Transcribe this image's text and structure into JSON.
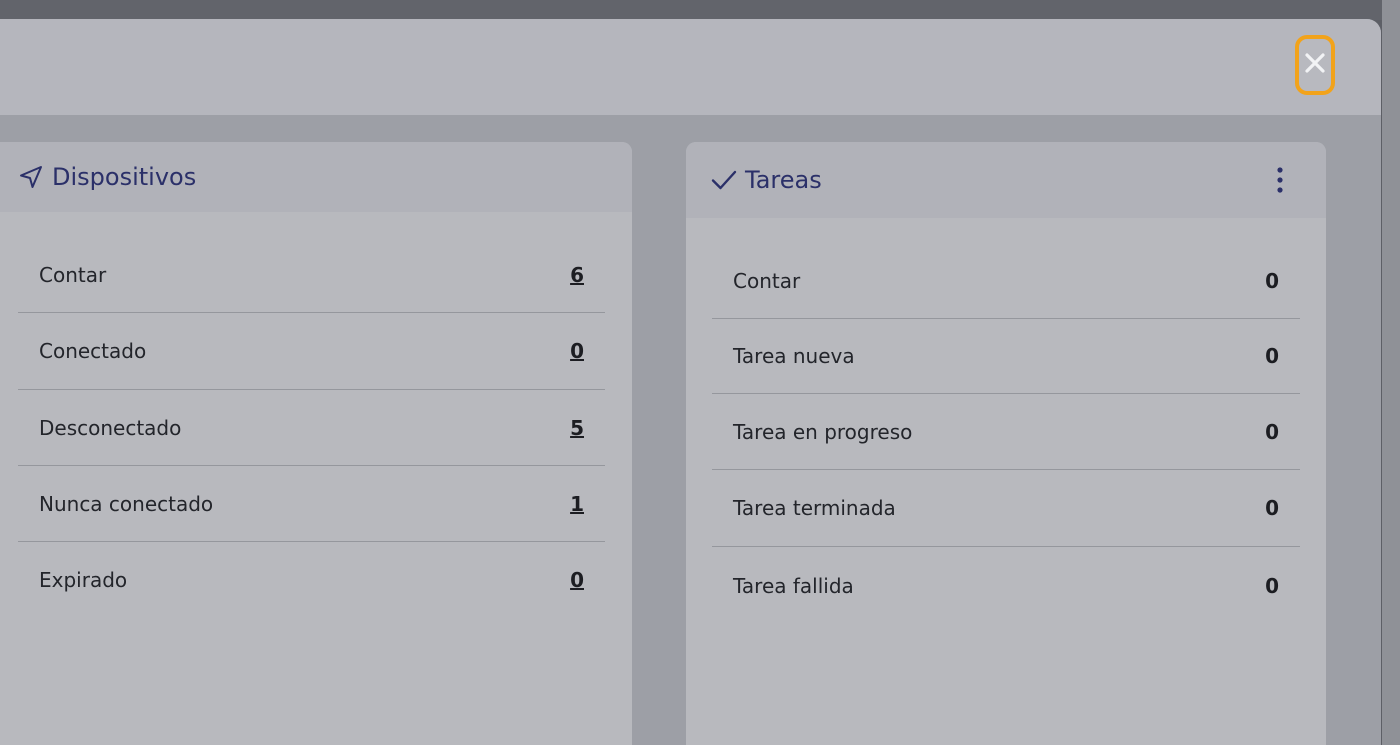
{
  "devices_card": {
    "title": "Dispositivos",
    "icon": "navigation-arrow-icon",
    "rows": [
      {
        "label": "Contar",
        "value": "6"
      },
      {
        "label": "Conectado",
        "value": "0"
      },
      {
        "label": "Desconectado",
        "value": "5"
      },
      {
        "label": "Nunca conectado",
        "value": "1"
      },
      {
        "label": "Expirado",
        "value": "0"
      }
    ]
  },
  "tasks_card": {
    "title": "Tareas",
    "icon": "check-icon",
    "menu_icon": "more-vertical-icon",
    "rows": [
      {
        "label": "Contar",
        "value": "0"
      },
      {
        "label": "Tarea nueva",
        "value": "0"
      },
      {
        "label": "Tarea en progreso",
        "value": "0"
      },
      {
        "label": "Tarea terminada",
        "value": "0"
      },
      {
        "label": "Tarea fallida",
        "value": "0"
      }
    ]
  },
  "colors": {
    "accent_focus": "#f2a31b",
    "title_color": "#2b3069",
    "card_bg": "#b8b9be"
  }
}
